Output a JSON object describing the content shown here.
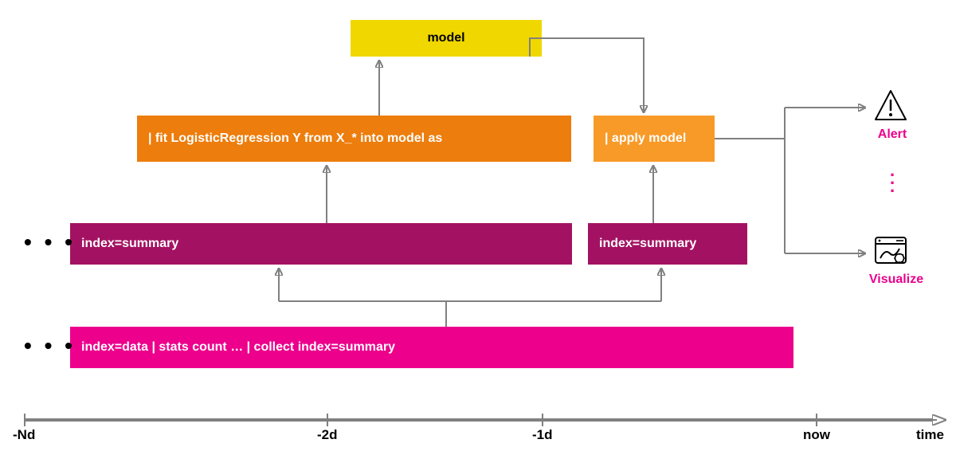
{
  "boxes": {
    "model_label": "model",
    "fit_label": "| fit LogisticRegression Y from X_* into model as",
    "apply_label": "| apply model",
    "summary_train_label": "index=summary",
    "summary_apply_label": "index=summary",
    "data_label": "index=data | stats count … | collect index=summary"
  },
  "axis": {
    "ticks": [
      "-Nd",
      "-2d",
      "-1d",
      "now"
    ],
    "axis_label": "time"
  },
  "outputs": {
    "alert_label": "Alert",
    "visualize_label": "Visualize"
  },
  "colors": {
    "model": "#f0d700",
    "fit": "#ed7d0c",
    "apply": "#f89a28",
    "summary": "#a31262",
    "data": "#ec008c",
    "arrow": "#808080",
    "accent": "#ec008c"
  }
}
